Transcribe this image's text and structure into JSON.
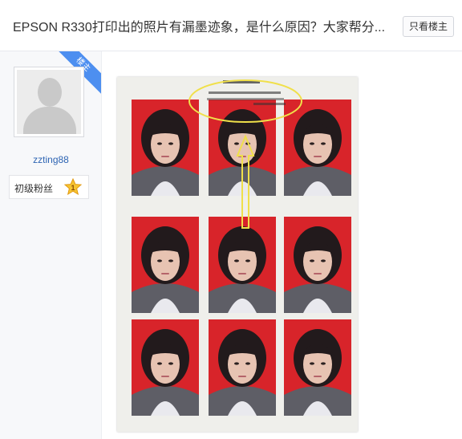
{
  "header": {
    "title": "EPSON R330打印出的照片有漏墨迹象，是什么原因？大家帮分...",
    "only_op_label": "只看楼主"
  },
  "author": {
    "badge": "楼主",
    "username": "zzting88",
    "level_name": "初级粉丝",
    "level_number": "1",
    "avatar_icon": "default-avatar-icon",
    "star_icon": "level-star-icon"
  },
  "post": {
    "image_icon": "photo-sheet-image",
    "highlight_color": "#f0e04a",
    "photo_bg_color": "#d8242a"
  },
  "colors": {
    "accent": "#4d8ff0",
    "link": "#2d64b3"
  }
}
